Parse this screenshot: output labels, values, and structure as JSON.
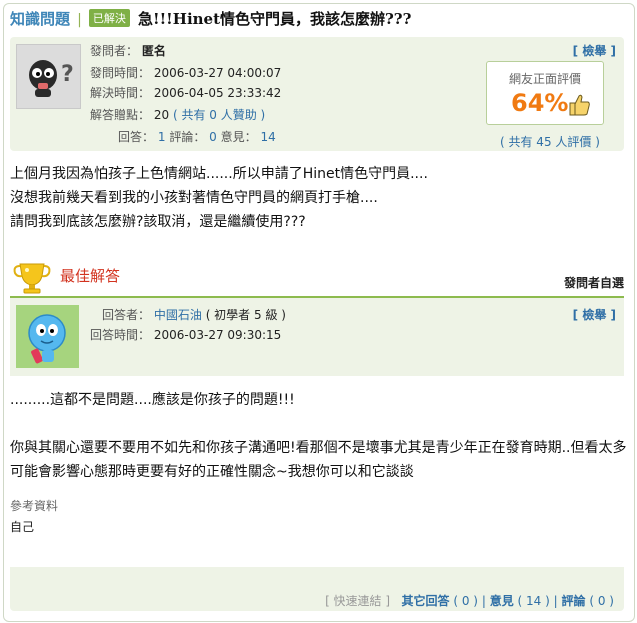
{
  "header": {
    "brand": "知識問題",
    "separator": "|",
    "status_badge": "已解決",
    "question_title": "急!!!Hinet情色守門員，我該怎麼辦???"
  },
  "question_meta": {
    "asker_label": "發問者：",
    "asker_value": "匿名",
    "ask_time_label": "發問時間：",
    "ask_time_value": "2006-03-27 04:00:07",
    "solve_time_label": "解決時間：",
    "solve_time_value": "2006-04-05 23:33:42",
    "points_label": "解答贈點：",
    "points_value": "20",
    "sponsor_text": "( 共有 0 人贊助 )",
    "answers_label": "回答：",
    "answers_value": "1",
    "comments_label": "評論：",
    "comments_value": "0",
    "opinions_label": "意見：",
    "opinions_value": "14",
    "report_link": "[ 檢舉 ]",
    "rating_title": "網友正面評價",
    "rating_percent": "64%",
    "rating_votes": "( 共有 45 人評價 )"
  },
  "question_body": [
    "上個月我因為怕孩子上色情網站......所以申請了Hinet情色守門員....",
    "沒想我前幾天看到我的小孩對著情色守門員的網頁打手槍....",
    "請問我到底該怎麼辦?該取消，還是繼續使用???"
  ],
  "best_answer": {
    "heading": "最佳解答",
    "choice_label": "發問者自選",
    "answerer_label": "回答者：",
    "answerer_name": "中國石油",
    "answerer_level": "( 初學者 5 級 )",
    "answer_time_label": "回答時間：",
    "answer_time_value": "2006-03-27 09:30:15",
    "report_link": "[ 檢舉 ]",
    "body": [
      ".........這都不是問題....應該是你孩子的問題!!!",
      "你與其關心還要不要用不如先和你孩子溝通吧!看那個不是壞事尤其是青少年正在發育時期..但看太多可能會影響心態那時更要有好的正確性關念~我想你可以和它談談"
    ],
    "reference_title": "參考資料",
    "reference_body": "自己"
  },
  "footer": {
    "quick_link": "[ 快速連結 ]",
    "other_answers": "其它回答",
    "other_answers_count": "( 0 )",
    "opinions": "意見",
    "opinions_count": "( 14 )",
    "comments": "評論",
    "comments_count": "( 0 )",
    "divider": "|"
  },
  "colors": {
    "brand_blue": "#3f86b8",
    "accent_green": "#7fb046",
    "panel_bg": "#eef3e6",
    "percent_orange": "#f07a12",
    "best_red": "#d2331f"
  },
  "icons": [
    "anonymous-avatar-icon",
    "thumbs-up-icon",
    "trophy-icon",
    "answerer-avatar-icon"
  ]
}
